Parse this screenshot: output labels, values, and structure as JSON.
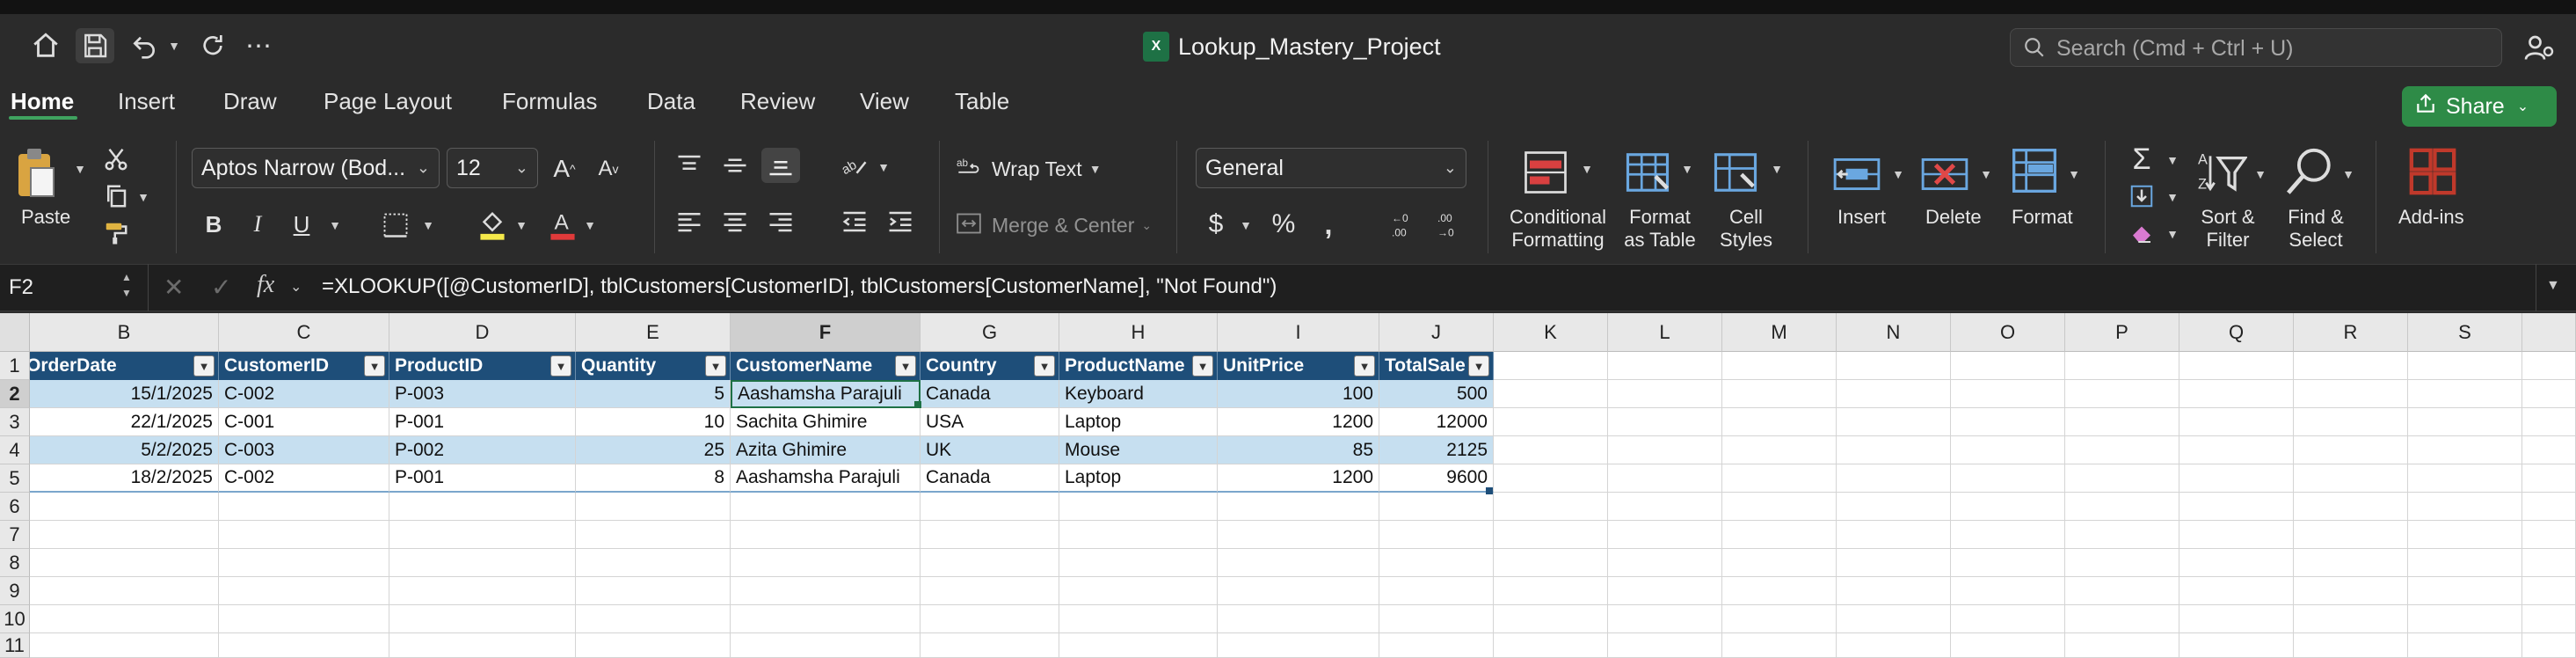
{
  "window": {
    "title": "Lookup_Mastery_Project"
  },
  "search": {
    "placeholder": "Search (Cmd + Ctrl + U)"
  },
  "tabs": [
    {
      "label": "Home"
    },
    {
      "label": "Insert"
    },
    {
      "label": "Draw"
    },
    {
      "label": "Page Layout"
    },
    {
      "label": "Formulas"
    },
    {
      "label": "Data"
    },
    {
      "label": "Review"
    },
    {
      "label": "View"
    },
    {
      "label": "Table"
    }
  ],
  "share": {
    "label": "Share"
  },
  "ribbon": {
    "paste": "Paste",
    "font_name": "Aptos Narrow (Bod...",
    "font_size": "12",
    "wrap_text": "Wrap Text",
    "merge_center": "Merge & Center",
    "number_format": "General",
    "conditional_formatting": [
      "Conditional",
      "Formatting"
    ],
    "format_as_table": [
      "Format",
      "as Table"
    ],
    "cell_styles": [
      "Cell",
      "Styles"
    ],
    "insert": "Insert",
    "delete": "Delete",
    "format": "Format",
    "sort_filter": [
      "Sort &",
      "Filter"
    ],
    "find_select": [
      "Find &",
      "Select"
    ],
    "addins": "Add-ins",
    "colors": {
      "fill": "#f5e94a",
      "font": "#e03a3a",
      "addins": "#c0392b"
    }
  },
  "formula_bar": {
    "name_box": "F2",
    "formula": "=XLOOKUP([@CustomerID], tblCustomers[CustomerID], tblCustomers[CustomerName], \"Not Found\")"
  },
  "sheet": {
    "columns": [
      "B",
      "C",
      "D",
      "E",
      "F",
      "G",
      "H",
      "I",
      "J",
      "K",
      "L",
      "M",
      "N",
      "O",
      "P",
      "Q",
      "R",
      "S"
    ],
    "rows": [
      "1",
      "2",
      "3",
      "4",
      "5",
      "6",
      "7",
      "8",
      "9",
      "10",
      "11"
    ],
    "headers": [
      "OrderDate",
      "CustomerID",
      "ProductID",
      "Quantity",
      "CustomerName",
      "Country",
      "ProductName",
      "UnitPrice",
      "TotalSale"
    ],
    "data": [
      [
        "15/1/2025",
        "C-002",
        "P-003",
        "5",
        "Aashamsha Parajuli",
        "Canada",
        "Keyboard",
        "100",
        "500"
      ],
      [
        "22/1/2025",
        "C-001",
        "P-001",
        "10",
        "Sachita Ghimire",
        "USA",
        "Laptop",
        "1200",
        "12000"
      ],
      [
        "5/2/2025",
        "C-003",
        "P-002",
        "25",
        "Azita Ghimire",
        "UK",
        "Mouse",
        "85",
        "2125"
      ],
      [
        "18/2/2025",
        "C-002",
        "P-001",
        "8",
        "Aashamsha Parajuli",
        "Canada",
        "Laptop",
        "1200",
        "9600"
      ]
    ],
    "colors": {
      "header_fill": "#1e4e79",
      "band_fill": "#c6dff0"
    }
  }
}
